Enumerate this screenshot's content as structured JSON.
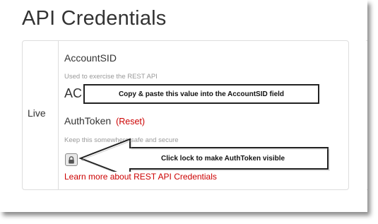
{
  "page": {
    "title": "API Credentials"
  },
  "panel": {
    "environment": "Live",
    "account_sid": {
      "label": "AccountSID",
      "help": "Used to exercise the REST API",
      "value_prefix": "AC"
    },
    "auth_token": {
      "label": "AuthToken",
      "reset_label": "(Reset)",
      "help": "Keep this somewhere safe and secure",
      "masked_value": "●●●●●●●●●●●●●●●●●●●●●●●●●●●●●●●●"
    },
    "learn_more": "Learn more about REST API Credentials"
  },
  "annotations": {
    "callout_sid": "Copy & paste this value into the AccountSID field",
    "callout_lock": "Click lock to make AuthToken visible"
  },
  "colors": {
    "link_red": "#cc0000",
    "border": "#dddddd",
    "text": "#333333"
  },
  "icons": {
    "lock": "lock-icon"
  }
}
